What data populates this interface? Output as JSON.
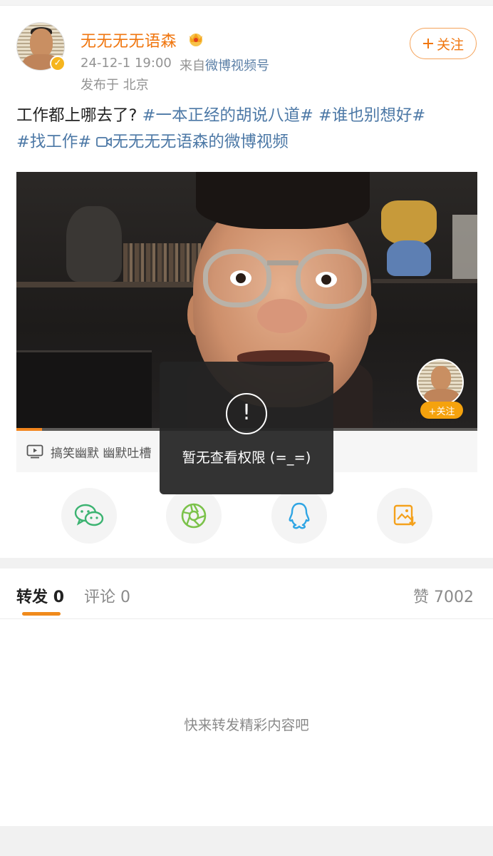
{
  "post": {
    "username": "无无无无语森",
    "time": "24-12-1 19:00",
    "source_prefix": "来自",
    "source": "微博视频号",
    "location": "发布于 北京",
    "follow_label": "关注",
    "text_plain": "工作都上哪去了?",
    "tags": [
      "#一本正经的胡说八道#",
      "#谁也别想好#",
      "#找工作#"
    ],
    "video_link": "无无无无语森的微博视频"
  },
  "video": {
    "mini_follow_label": "+关注",
    "progress_fraction": 0.055,
    "tags_text": "搞笑幽默 幽默吐槽"
  },
  "toast": {
    "icon": "!",
    "message": "暂无查看权限 (=_=)"
  },
  "share": {
    "items": [
      "wechat-icon",
      "moments-icon",
      "qq-icon",
      "save-image-icon"
    ]
  },
  "tabs": {
    "repost_label": "转发",
    "repost_count": "0",
    "comment_label": "评论",
    "comment_count": "0",
    "like_label": "赞",
    "like_count": "7002"
  },
  "empty": {
    "message": "快来转发精彩内容吧"
  },
  "colors": {
    "accent": "#f0760f",
    "link": "#4c78a6",
    "tab_underline": "#f08a1b"
  }
}
